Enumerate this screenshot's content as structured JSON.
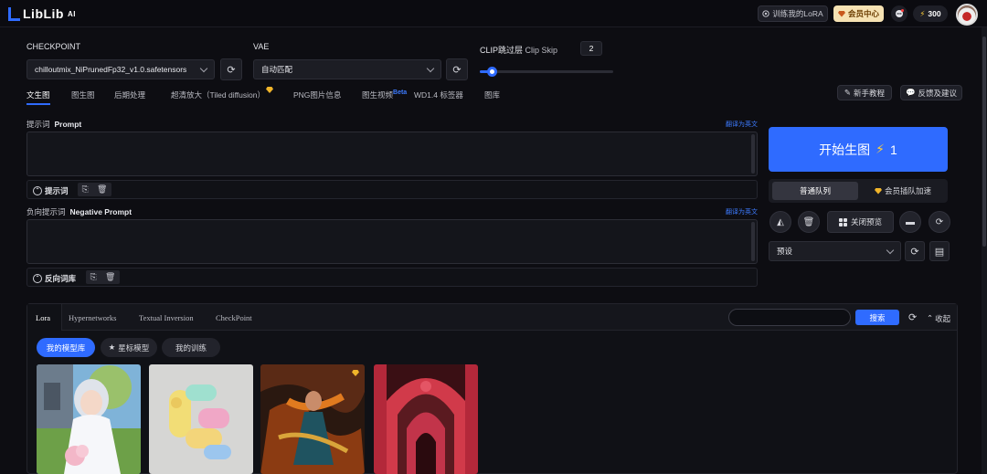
{
  "header": {
    "logo_text": "LibLib",
    "logo_suffix": "AI",
    "train_lora": "训练我的LoRA",
    "vip_center": "会员中心",
    "points": "300"
  },
  "model": {
    "checkpoint_label": "CHECKPOINT",
    "checkpoint_value": "chilloutmix_NiPrunedFp32_v1.0.safetensors",
    "vae_label": "VAE",
    "vae_value": "自动匹配",
    "clip_label_cn": "CLIP跳过层",
    "clip_label_en": "Clip Skip",
    "clip_value": "2",
    "clip_slider_fraction": 0.1
  },
  "tabs": [
    {
      "label": "文生图",
      "active": true
    },
    {
      "label": "图生图"
    },
    {
      "label": "后期处理"
    },
    {
      "label": "超清放大（Tiled diffusion）"
    },
    {
      "label": "PNG图片信息"
    },
    {
      "label": "图生视频",
      "badge": "Beta"
    },
    {
      "label": "WD1.4 标签器"
    },
    {
      "label": "图库"
    }
  ],
  "help": {
    "tutorial": "新手教程",
    "feedback": "反馈及建议"
  },
  "prompt": {
    "label_cn": "提示词",
    "label_en": "Prompt",
    "translate": "翻译为英文",
    "value": "",
    "toggle_label": "提示词"
  },
  "negative": {
    "label_cn": "负向提示词",
    "label_en": "Negative Prompt",
    "translate": "翻译为英文",
    "value": "",
    "toggle_label": "反向词库"
  },
  "generate": {
    "label": "开始生图",
    "cost": "1",
    "queue_normal": "普通队列",
    "queue_vip": "会员插队加速",
    "close_preview": "关闭预览",
    "preset_placeholder": "预设"
  },
  "library": {
    "tabs": [
      "Lora",
      "Hypernetworks",
      "Textual Inversion",
      "CheckPoint"
    ],
    "active_tab": "Lora",
    "search_placeholder": "",
    "search_button": "搜索",
    "collapse": "收起",
    "chips": [
      "我的模型库",
      "星标模型",
      "我的训练"
    ]
  },
  "colors": {
    "accent": "#2f6bff",
    "background": "#0d0d12",
    "vip_gold": "#f1b52a"
  }
}
